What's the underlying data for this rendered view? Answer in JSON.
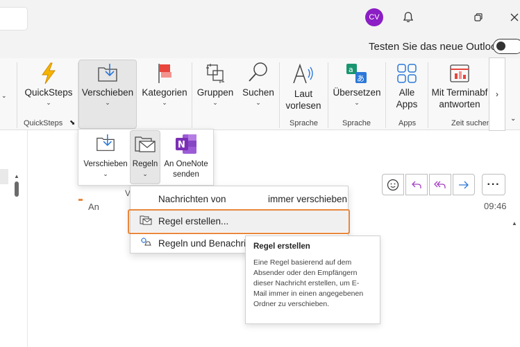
{
  "titlebar": {
    "avatar_initials": "CV",
    "icons": [
      "bell-icon",
      "restore-icon",
      "close-icon"
    ]
  },
  "outlook_toggle": {
    "label": "Testen Sie das neue Outlook",
    "state": "off"
  },
  "ribbon": {
    "quicksteps": {
      "label": "QuickSteps",
      "group": "QuickSteps"
    },
    "verschieben": {
      "label": "Verschieben"
    },
    "kategorien": {
      "label": "Kategorien"
    },
    "gruppen": {
      "label": "Gruppen"
    },
    "suchen": {
      "label": "Suchen"
    },
    "laut_vorlesen": {
      "label_line1": "Laut",
      "label_line2": "vorlesen",
      "group": "Sprache"
    },
    "uebersetzen": {
      "label": "Übersetzen",
      "group": "Sprache"
    },
    "alle_apps": {
      "label_line1": "Alle",
      "label_line2": "Apps",
      "group": "Apps"
    },
    "terminabfrage": {
      "label_line1": "Mit Terminabf",
      "label_line2": "antworten",
      "group": "Zeit suchen"
    }
  },
  "move_dropdown": {
    "verschieben": "Verschieben",
    "regeln": "Regeln",
    "onenote_line1": "An OneNote",
    "onenote_line2": "senden"
  },
  "rules_menu": {
    "items": [
      {
        "label": "Nachrichten von",
        "label_right": "immer verschieben"
      },
      {
        "label": "Regel erstellen..."
      },
      {
        "label": "Regeln und Benachrich"
      }
    ]
  },
  "tooltip": {
    "title": "Regel erstellen",
    "body": "Eine Regel basierend auf dem Absender oder den Empfängern dieser Nachricht erstellen, um E-Mail immer in einen angegebenen Ordner zu verschieben."
  },
  "message": {
    "to_label": "An",
    "time": "09:46",
    "partial_char": "V"
  },
  "colors": {
    "accent_orange": "#e8873b",
    "avatar": "#8b1ec4",
    "reply_purple": "#a43ec2",
    "forward_blue": "#2b78d8"
  }
}
